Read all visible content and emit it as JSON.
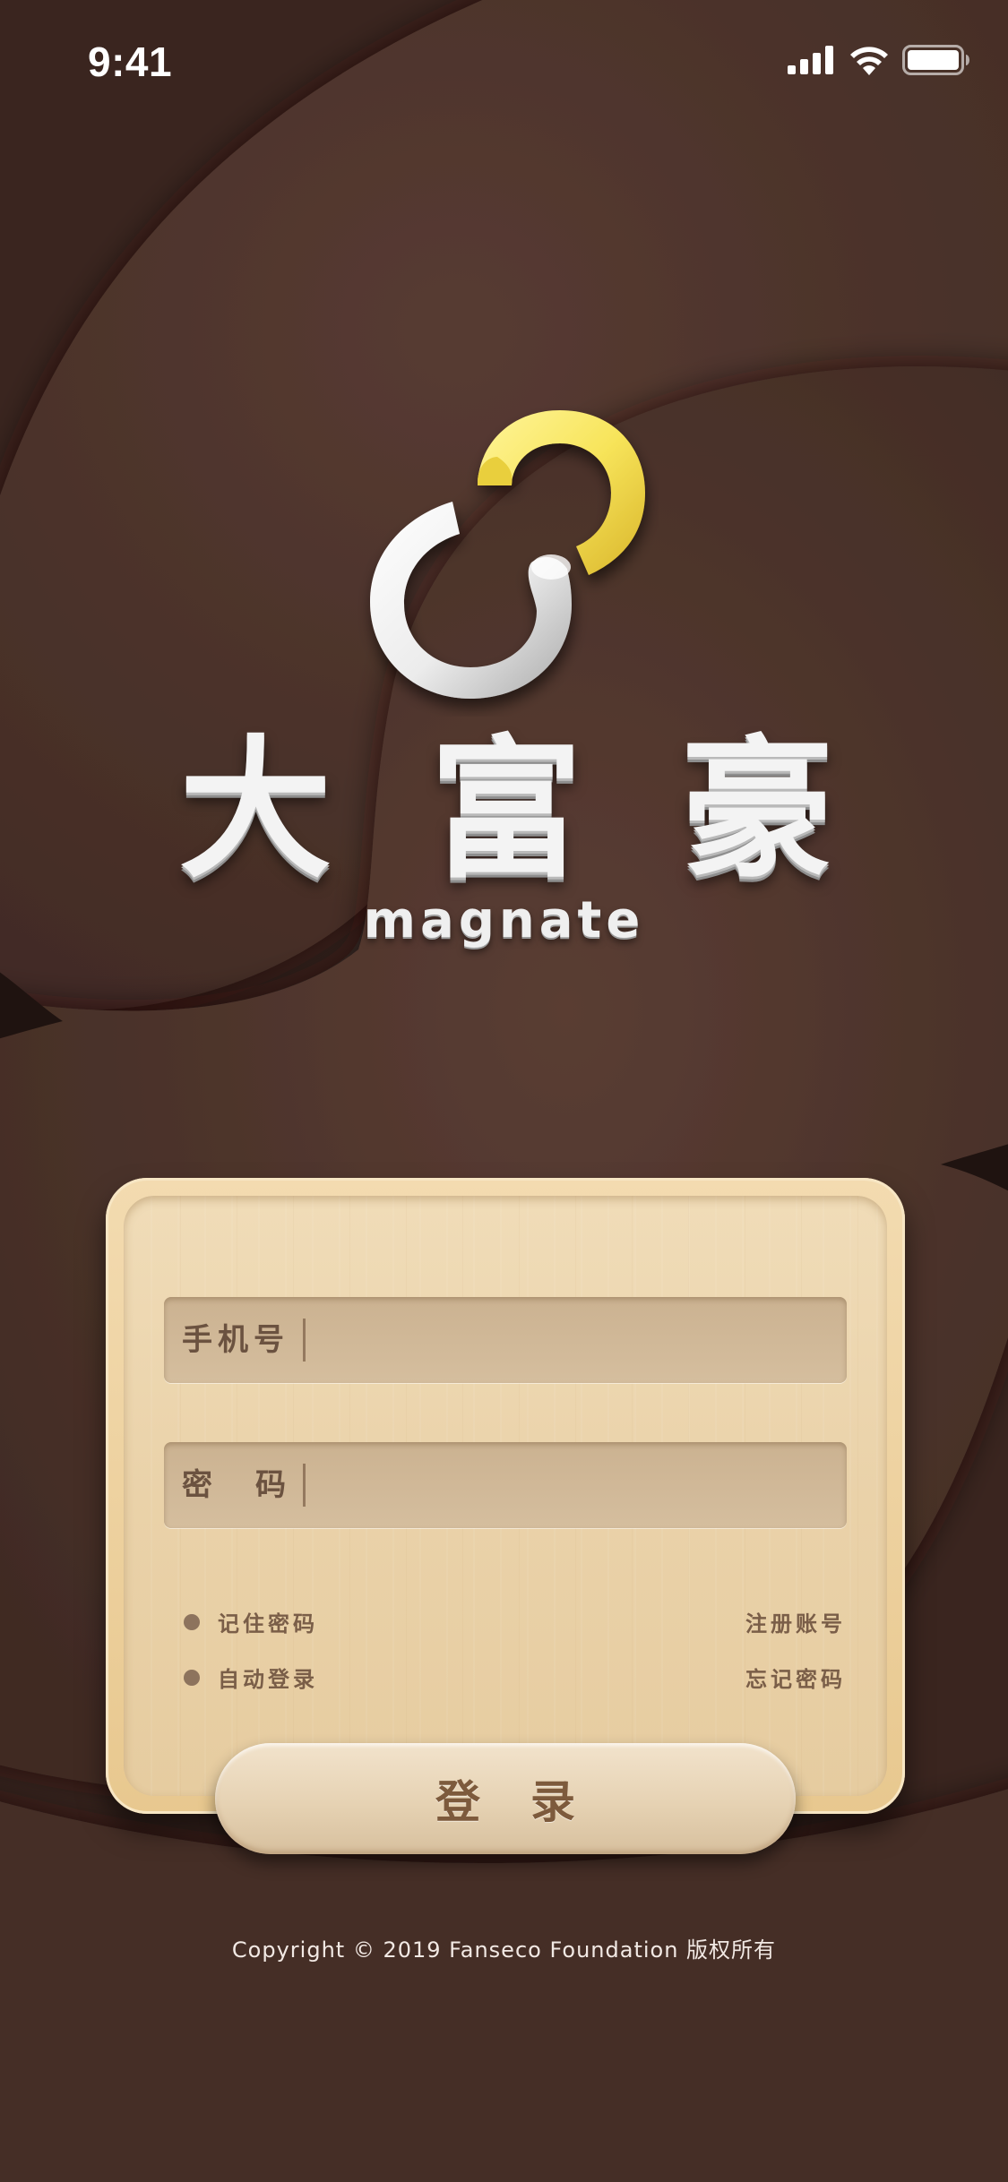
{
  "status_bar": {
    "time": "9:41"
  },
  "brand": {
    "title_chars": [
      "大",
      "富",
      "豪"
    ],
    "subtitle": "magnate"
  },
  "form": {
    "phone_label": "手机号",
    "phone_value": "",
    "password_label": "密码",
    "password_value": "",
    "remember_password": "记住密码",
    "auto_login": "自动登录",
    "register": "注册账号",
    "forgot_password": "忘记密码",
    "login_button": "登录"
  },
  "footer": {
    "copyright": "Copyright © 2019 Fanseco Foundation 版权所有"
  },
  "colors": {
    "background": "#3d2720",
    "card": "#ead2a9",
    "logo_yellow": "#f5df52",
    "logo_white": "#f2f2f2",
    "text_brown": "#7a5e48"
  },
  "icons": [
    "cellular-signal-icon",
    "wifi-icon",
    "battery-icon"
  ]
}
